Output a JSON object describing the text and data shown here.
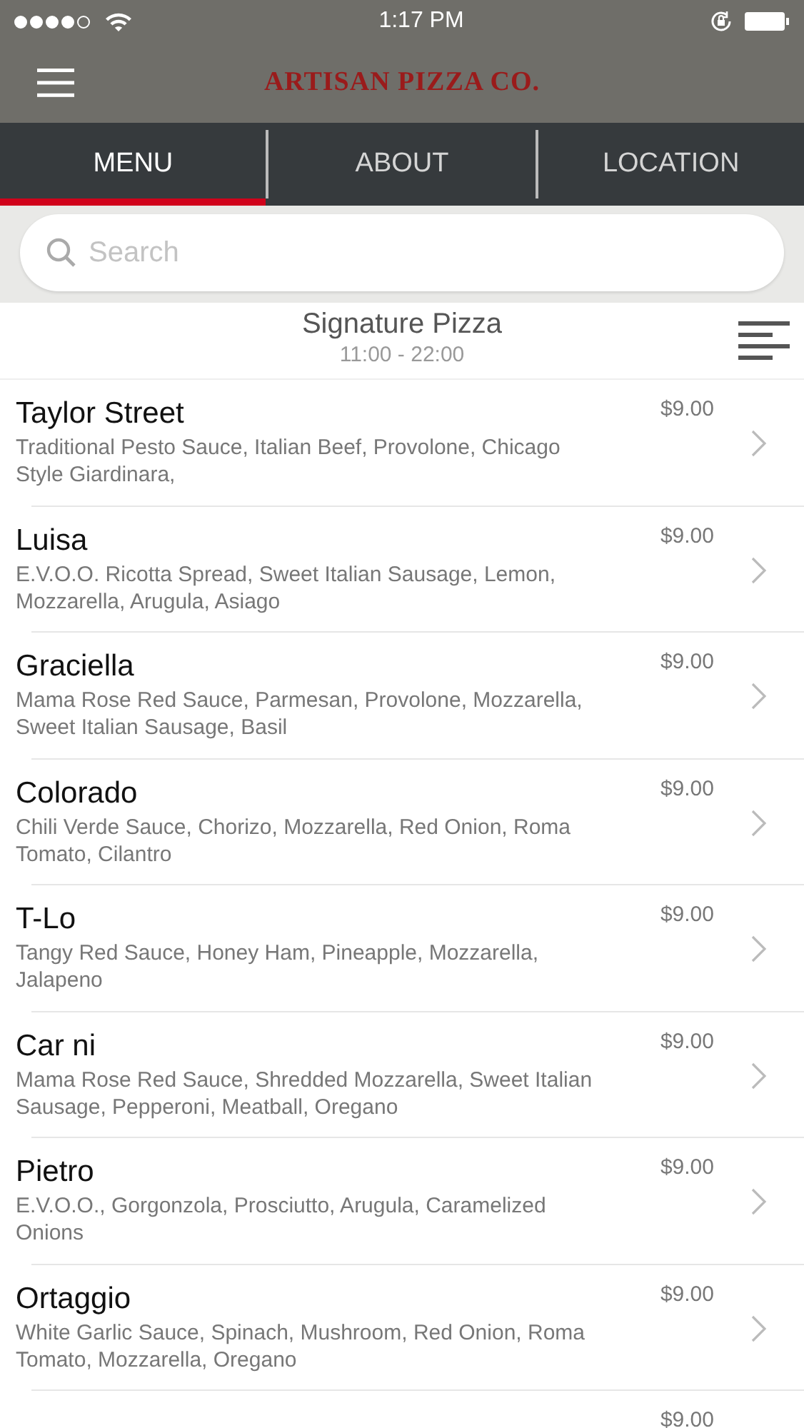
{
  "status_bar": {
    "signal_dots": [
      {
        "on": true
      },
      {
        "on": true
      },
      {
        "on": true
      },
      {
        "on": true
      },
      {
        "on": false
      }
    ],
    "time": "1:17 PM"
  },
  "header": {
    "title": "ARTISAN PIZZA CO."
  },
  "tabs": [
    {
      "label": "MENU",
      "selected": true
    },
    {
      "label": "ABOUT",
      "selected": false
    },
    {
      "label": "LOCATION",
      "selected": false
    }
  ],
  "search": {
    "placeholder": "Search"
  },
  "section": {
    "title": "Signature Pizza",
    "hours": "11:00 - 22:00"
  },
  "items": [
    {
      "name": "Taylor Street",
      "description": "Traditional Pesto Sauce, Italian Beef, Provolone, Chicago Style Giardinara,",
      "price": "$9.00"
    },
    {
      "name": "Luisa",
      "description": "E.V.O.O. Ricotta Spread, Sweet Italian Sausage, Lemon, Mozzarella, Arugula, Asiago",
      "price": "$9.00"
    },
    {
      "name": "Graciella",
      "description": "Mama Rose Red Sauce, Parmesan, Provolone, Mozzarella, Sweet Italian Sausage, Basil",
      "price": "$9.00"
    },
    {
      "name": "Colorado",
      "description": "Chili Verde Sauce, Chorizo, Mozzarella, Red Onion, Roma Tomato, Cilantro",
      "price": "$9.00"
    },
    {
      "name": "T-Lo",
      "description": "Tangy Red Sauce, Honey Ham, Pineapple, Mozzarella, Jalapeno",
      "price": "$9.00"
    },
    {
      "name": "Car ni",
      "description": "Mama Rose Red Sauce, Shredded Mozzarella, Sweet Italian Sausage, Pepperoni, Meatball, Oregano",
      "price": "$9.00"
    },
    {
      "name": "Pietro",
      "description": "E.V.O.O., Gorgonzola, Prosciutto, Arugula, Caramelized Onions",
      "price": "$9.00"
    },
    {
      "name": "Ortaggio",
      "description": "White Garlic Sauce, Spinach, Mushroom, Red Onion, Roma Tomato, Mozzarella, Oregano",
      "price": "$9.00"
    },
    {
      "price": "$9.00"
    }
  ]
}
